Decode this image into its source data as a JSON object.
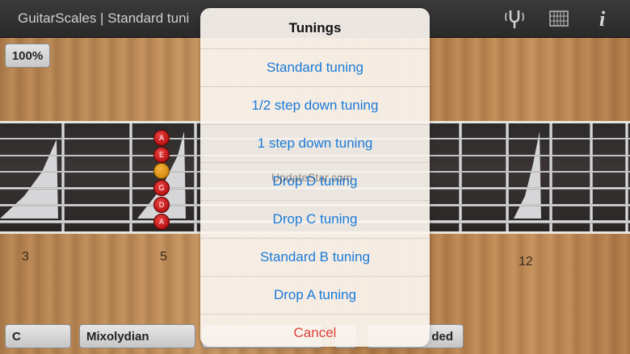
{
  "header": {
    "title": "GuitarScales | Standard tuni"
  },
  "toolbar": {
    "zoom": "100%",
    "icons": [
      "tuning-fork-icon",
      "chord-grid-icon",
      "info-icon"
    ]
  },
  "fretboard": {
    "fret_labels": [
      "3",
      "5",
      "12"
    ],
    "notes": [
      "A",
      "E",
      "",
      "G",
      "D",
      "A"
    ]
  },
  "bottom": {
    "key": "C",
    "mode": "Mixolydian",
    "extra": "ded"
  },
  "watermark": "UpdateStar.com",
  "sheet": {
    "title": "Tunings",
    "items": [
      "Standard tuning",
      "1/2 step down tuning",
      "1 step down tuning",
      "Drop D tuning",
      "Drop C tuning",
      "Standard B tuning",
      "Drop A tuning"
    ],
    "cancel": "Cancel"
  },
  "colors": {
    "accent": "#1a7ad9",
    "destructive": "#e0413a",
    "note": "#c00000",
    "root_note": "#e6a020"
  }
}
